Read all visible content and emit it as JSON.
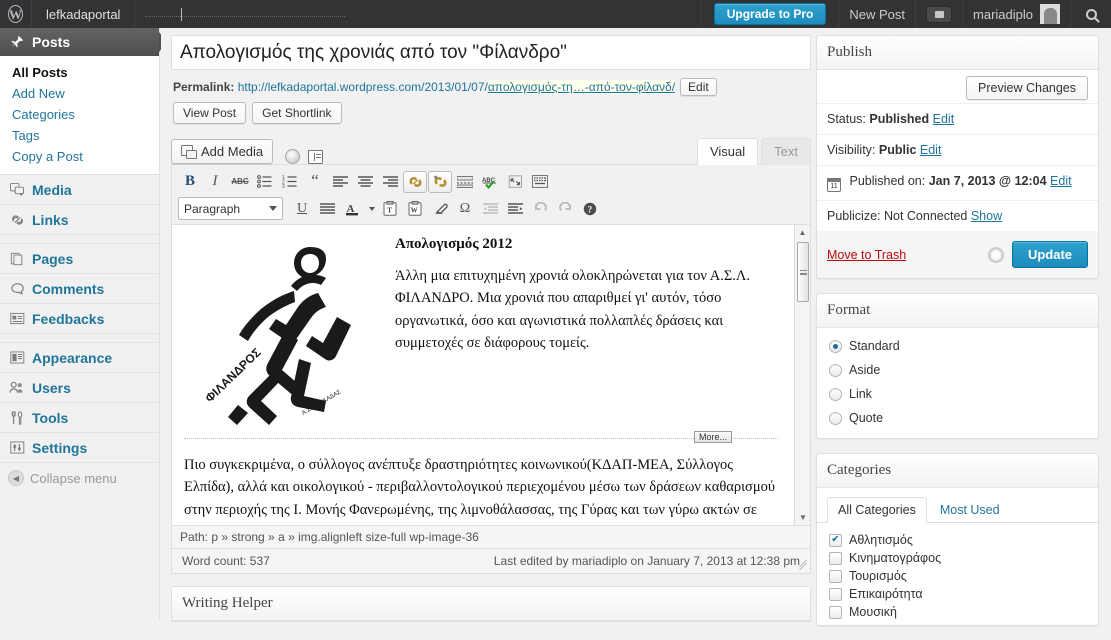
{
  "adminbar": {
    "logo_icon": "wordpress-icon",
    "site_name": "lefkadaportal",
    "upgrade_label": "Upgrade to Pro",
    "new_post_label": "New Post",
    "comments_icon": "comment-bubble-icon",
    "user_name": "mariadiplo",
    "avatar_icon": "avatar-icon",
    "search_icon": "search-icon"
  },
  "sidebar": {
    "current": {
      "label": "Posts",
      "icon": "pin-icon"
    },
    "submenu": [
      {
        "label": "All Posts",
        "current": true
      },
      {
        "label": "Add New",
        "current": false
      },
      {
        "label": "Categories",
        "current": false
      },
      {
        "label": "Tags",
        "current": false
      },
      {
        "label": "Copy a Post",
        "current": false
      }
    ],
    "items": [
      {
        "label": "Media",
        "icon": "media-icon"
      },
      {
        "label": "Links",
        "icon": "link-icon"
      },
      {
        "label": "Pages",
        "icon": "pages-icon"
      },
      {
        "label": "Comments",
        "icon": "comment-icon"
      },
      {
        "label": "Feedbacks",
        "icon": "feedback-icon"
      },
      {
        "label": "Appearance",
        "icon": "appearance-icon"
      },
      {
        "label": "Users",
        "icon": "users-icon"
      },
      {
        "label": "Tools",
        "icon": "tools-icon"
      },
      {
        "label": "Settings",
        "icon": "settings-icon"
      }
    ],
    "collapse_label": "Collapse menu"
  },
  "post": {
    "title": "Απολογισμός της χρονιάς από τον \"Φίλανδρο\"",
    "permalink_label": "Permalink:",
    "permalink_base": "http://lefkadaportal.wordpress.com/2013/01/07/",
    "permalink_slug": "απολογισμός-τη…-από-τον-φίλανδ/",
    "edit_permalink_label": "Edit",
    "view_post_label": "View Post",
    "get_shortlink_label": "Get Shortlink"
  },
  "editor": {
    "add_media_label": "Add Media",
    "media_extra_icons": [
      "polldaddy-icon",
      "contact-form-icon"
    ],
    "tabs": [
      {
        "label": "Visual",
        "active": true
      },
      {
        "label": "Text",
        "active": false
      }
    ],
    "toolbar_row1": [
      {
        "name": "bold-icon",
        "glyph": "B",
        "framed": false
      },
      {
        "name": "italic-icon",
        "glyph": "I",
        "framed": false
      },
      {
        "name": "strikethrough-icon",
        "glyph": "ABC",
        "framed": false
      },
      {
        "name": "bullet-list-icon",
        "glyph": "",
        "framed": false
      },
      {
        "name": "numbered-list-icon",
        "glyph": "",
        "framed": false
      },
      {
        "name": "blockquote-icon",
        "glyph": "“",
        "framed": false
      },
      {
        "name": "align-left-icon",
        "glyph": "",
        "framed": false
      },
      {
        "name": "align-center-icon",
        "glyph": "",
        "framed": false
      },
      {
        "name": "align-right-icon",
        "glyph": "",
        "framed": false
      },
      {
        "name": "insert-link-icon",
        "glyph": "",
        "framed": true
      },
      {
        "name": "unlink-icon",
        "glyph": "",
        "framed": true
      },
      {
        "name": "insert-more-icon",
        "glyph": "",
        "framed": false
      },
      {
        "name": "spellcheck-icon",
        "glyph": "",
        "framed": false
      },
      {
        "name": "fullscreen-icon",
        "glyph": "",
        "framed": false
      },
      {
        "name": "kitchen-sink-icon",
        "glyph": "",
        "framed": false
      }
    ],
    "format_select_value": "Paragraph",
    "toolbar_row2": [
      {
        "name": "underline-icon",
        "glyph": "U"
      },
      {
        "name": "justify-icon",
        "glyph": ""
      },
      {
        "name": "text-color-icon",
        "glyph": "A"
      },
      {
        "name": "paste-as-text-icon",
        "glyph": ""
      },
      {
        "name": "paste-from-word-icon",
        "glyph": ""
      },
      {
        "name": "remove-formatting-icon",
        "glyph": ""
      },
      {
        "name": "special-character-icon",
        "glyph": "Ω"
      },
      {
        "name": "outdent-icon",
        "glyph": ""
      },
      {
        "name": "indent-icon",
        "glyph": ""
      },
      {
        "name": "undo-icon",
        "glyph": "↶"
      },
      {
        "name": "redo-icon",
        "glyph": "↷"
      },
      {
        "name": "help-icon",
        "glyph": "?"
      }
    ],
    "content": {
      "heading": "Απολογισμός 2012",
      "paragraph1": "Άλλη μια επιτυχημένη χρονιά ολοκληρώνεται για τον Α.Σ.Λ. ΦΙΛΑΝΔΡΟ. Μια χρονιά που απαριθμεί γι' αυτόν, τόσο οργανωτικά, όσο και αγωνιστικά πολλαπλές δράσεις και συμμετοχές σε διάφορους τομείς.",
      "more_tag": "More...",
      "paragraph2": "Πιο συγκεκριμένα, ο σύλλογος ανέπτυξε δραστηριότητες κοινωνικού(ΚΔΑΠ-ΜΕΑ, Σύλλογος Ελπίδα), αλλά και οικολογικού - περιβαλλοντολογικού περιεχομένου μέσω των δράσεων καθαρισμού στην περιοχής της Ι. Μονής Φανερωμένης, της λιμνοθάλασσας, της Γύρας και των γύρω ακτών σε συνεργασία με τον ΣΚΑΙ TV & Ραδιόφωνο! Επίσης συμμετείχαμε στο",
      "image_alt": "ΦΙΛΑΝΔΡΟΣ Α.Σ. ΛΕΥΚΑΔΑΣ"
    },
    "path": "Path: p » strong » a » img.alignleft size-full wp-image-36",
    "word_count": "Word count: 537",
    "last_edited": "Last edited by mariadiplo on January 7, 2013 at 12:38 pm"
  },
  "writing_helper": {
    "title": "Writing Helper"
  },
  "publish": {
    "title": "Publish",
    "preview_label": "Preview Changes",
    "status_label": "Status:",
    "status_value": "Published",
    "status_edit": "Edit",
    "visibility_label": "Visibility:",
    "visibility_value": "Public",
    "visibility_edit": "Edit",
    "published_label": "Published on:",
    "published_value": "Jan 7, 2013 @ 12:04",
    "published_edit": "Edit",
    "calendar_day": "11",
    "publicize_label": "Publicize: Not Connected",
    "publicize_show": "Show",
    "trash_label": "Move to Trash",
    "update_label": "Update"
  },
  "format": {
    "title": "Format",
    "options": [
      {
        "label": "Standard",
        "selected": true
      },
      {
        "label": "Aside",
        "selected": false
      },
      {
        "label": "Link",
        "selected": false
      },
      {
        "label": "Quote",
        "selected": false
      }
    ]
  },
  "categories": {
    "title": "Categories",
    "tabs": [
      {
        "label": "All Categories",
        "active": true
      },
      {
        "label": "Most Used",
        "active": false
      }
    ],
    "items": [
      {
        "label": "Αθλητισμός",
        "checked": true
      },
      {
        "label": "Κινηματογράφος",
        "checked": false
      },
      {
        "label": "Τουρισμός",
        "checked": false
      },
      {
        "label": "Επικαιρότητα",
        "checked": false
      },
      {
        "label": "Μουσική",
        "checked": false
      }
    ]
  },
  "colors": {
    "accent": "#2ea2cc",
    "link": "#21759b",
    "trash": "#bc0b0b",
    "adminbar": "#333333"
  }
}
